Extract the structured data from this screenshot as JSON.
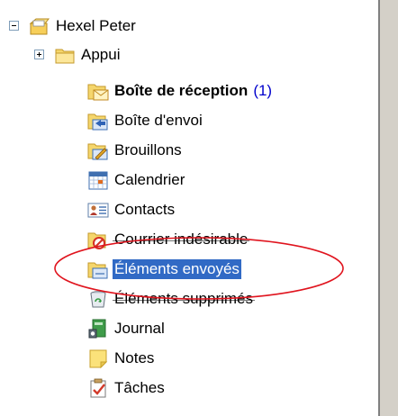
{
  "folder_tree": {
    "root": {
      "label": "Hexel Peter",
      "icon": "mailbox-icon"
    },
    "items": [
      {
        "label": "Appui",
        "icon": "folder-icon",
        "expander": "plus"
      },
      {
        "label": "Boîte de réception",
        "icon": "inbox-icon",
        "unread": "(1)",
        "bold": true
      },
      {
        "label": "Boîte d'envoi",
        "icon": "outbox-icon"
      },
      {
        "label": "Brouillons",
        "icon": "drafts-icon"
      },
      {
        "label": "Calendrier",
        "icon": "calendar-icon"
      },
      {
        "label": "Contacts",
        "icon": "contacts-icon"
      },
      {
        "label": "Courrier indésirable",
        "icon": "junk-mail-icon"
      },
      {
        "label": "Éléments envoyés",
        "icon": "sent-items-icon",
        "selected": true
      },
      {
        "label": "Éléments supprimés",
        "icon": "deleted-items-icon"
      },
      {
        "label": "Journal",
        "icon": "journal-icon"
      },
      {
        "label": "Notes",
        "icon": "notes-icon"
      },
      {
        "label": "Tâches",
        "icon": "tasks-icon"
      }
    ]
  },
  "colors": {
    "selection": "#316ac5",
    "annotation": "#e0141e",
    "unread_count": "#0000cc"
  }
}
